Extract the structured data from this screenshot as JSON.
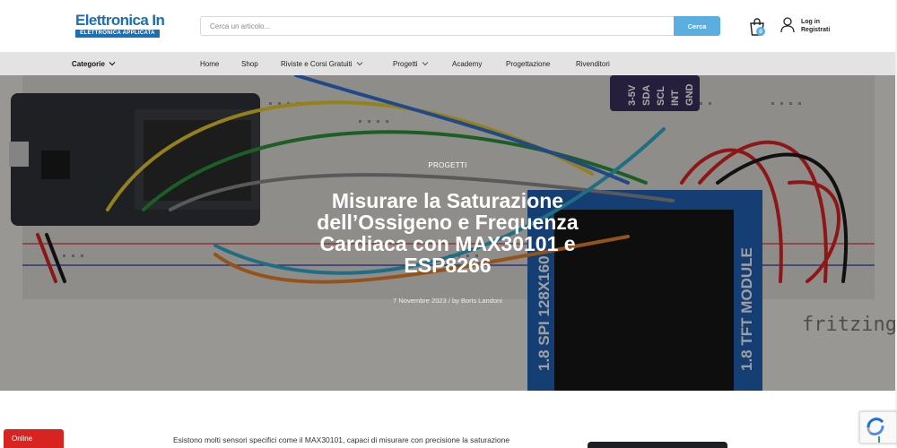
{
  "header": {
    "logo_title": "Elettronica In",
    "logo_subtitle": "ELETTRONICA APPLICATA",
    "search_placeholder": "Cerca un articolo...",
    "search_button": "Cerca",
    "cart_count": "0",
    "login_line1": "Log in",
    "login_line2": "Registrati"
  },
  "nav": {
    "categories_label": "Categorie",
    "items": [
      {
        "label": "Home"
      },
      {
        "label": "Shop"
      },
      {
        "label": "Riviste e Corsi Gratuiti"
      },
      {
        "label": "Progetti"
      },
      {
        "label": "Academy"
      },
      {
        "label": "Progettazione"
      },
      {
        "label": "Rivenditori"
      }
    ]
  },
  "hero": {
    "category": "PROGETTI",
    "title": "Misurare la Saturazione dell’Ossigeno e Frequenza Cardiaca con MAX30101 e ESP8266",
    "meta": "7 Novembre 2023 / by Boris Landoni",
    "image_labels": {
      "spi": "1.8 SPI 128X160",
      "tft": "1.8 TFT MODULE",
      "fritzing": "fritzing",
      "pins": [
        "3-5V",
        "SDA",
        "SCL",
        "INT",
        "GND"
      ]
    }
  },
  "body": {
    "intro": "Esistono molti sensori specifici come il MAX30101, capaci di misurare con precisione la saturazione"
  },
  "chat": {
    "label": "Online"
  },
  "colors": {
    "brand_blue": "#1a6fb7",
    "accent_blue": "#5aaee0",
    "chat_red": "#d82421"
  }
}
